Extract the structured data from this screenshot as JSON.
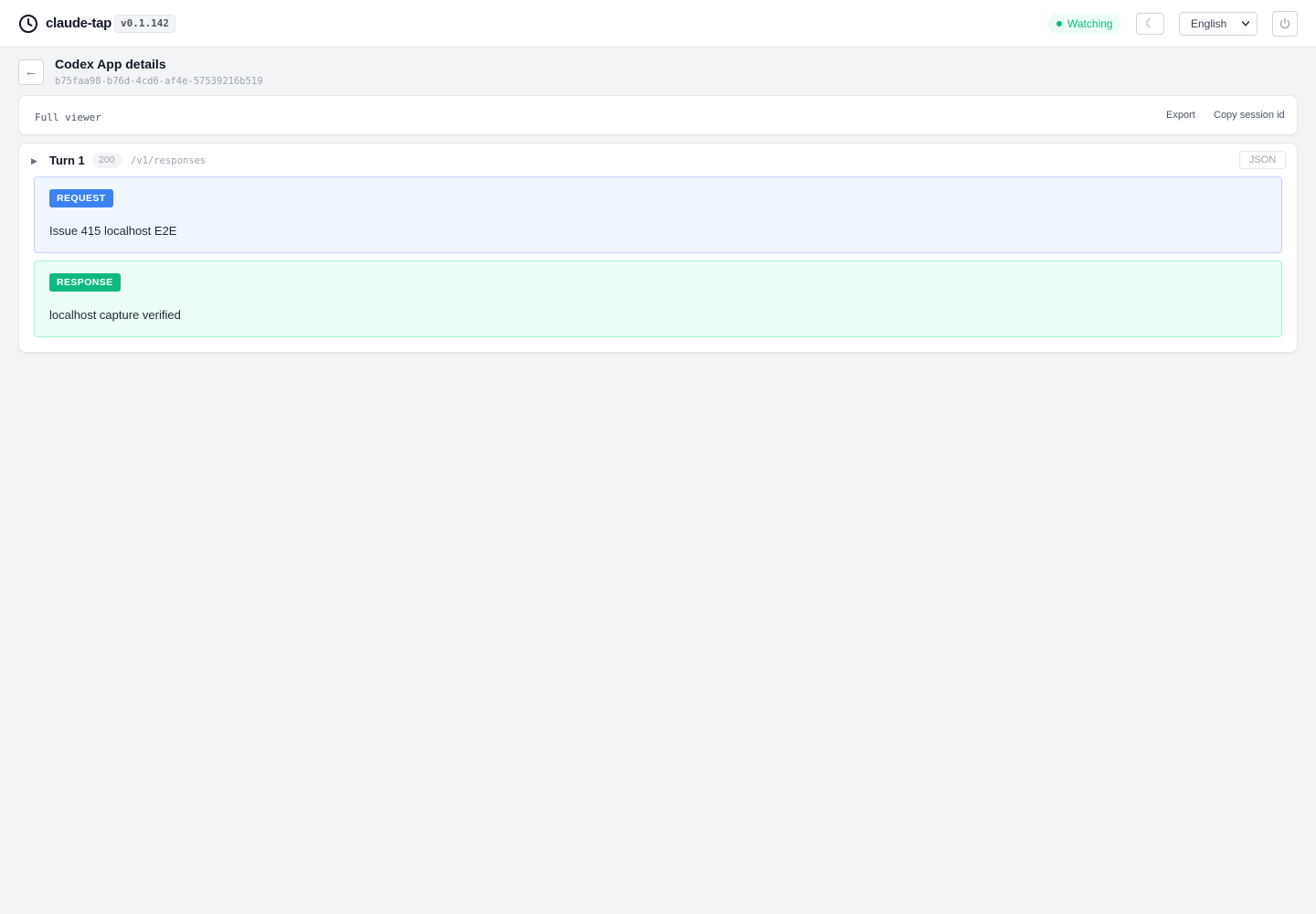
{
  "header": {
    "app_name": "claude-tap",
    "version": "v0.1.142",
    "status": "Watching",
    "theme_toggle_glyph": "☾",
    "language": "English",
    "icons": {
      "brand": "clock-icon",
      "theme": "moon-icon",
      "language": "chevron-down-icon",
      "power": "power-icon"
    }
  },
  "title_row": {
    "back_glyph": "←",
    "title": "Codex App details",
    "session_id": "b75faa98-b76d-4cd6-af4e-57539216b519"
  },
  "viewer_bar": {
    "label": "Full viewer",
    "export_label": "Export",
    "copy_label": "Copy session id"
  },
  "turn": {
    "expand_glyph": "▶",
    "label": "Turn 1",
    "status_code": "200",
    "endpoint": "/v1/responses",
    "json_label": "JSON",
    "request": {
      "badge": "REQUEST",
      "text": "Issue 415 localhost E2E"
    },
    "response": {
      "badge": "RESPONSE",
      "text": "localhost capture verified"
    }
  },
  "colors": {
    "accent_request": "#3b82f6",
    "accent_response": "#10b981",
    "status_watching": "#10b981",
    "page_background": "#f3f4f6"
  }
}
